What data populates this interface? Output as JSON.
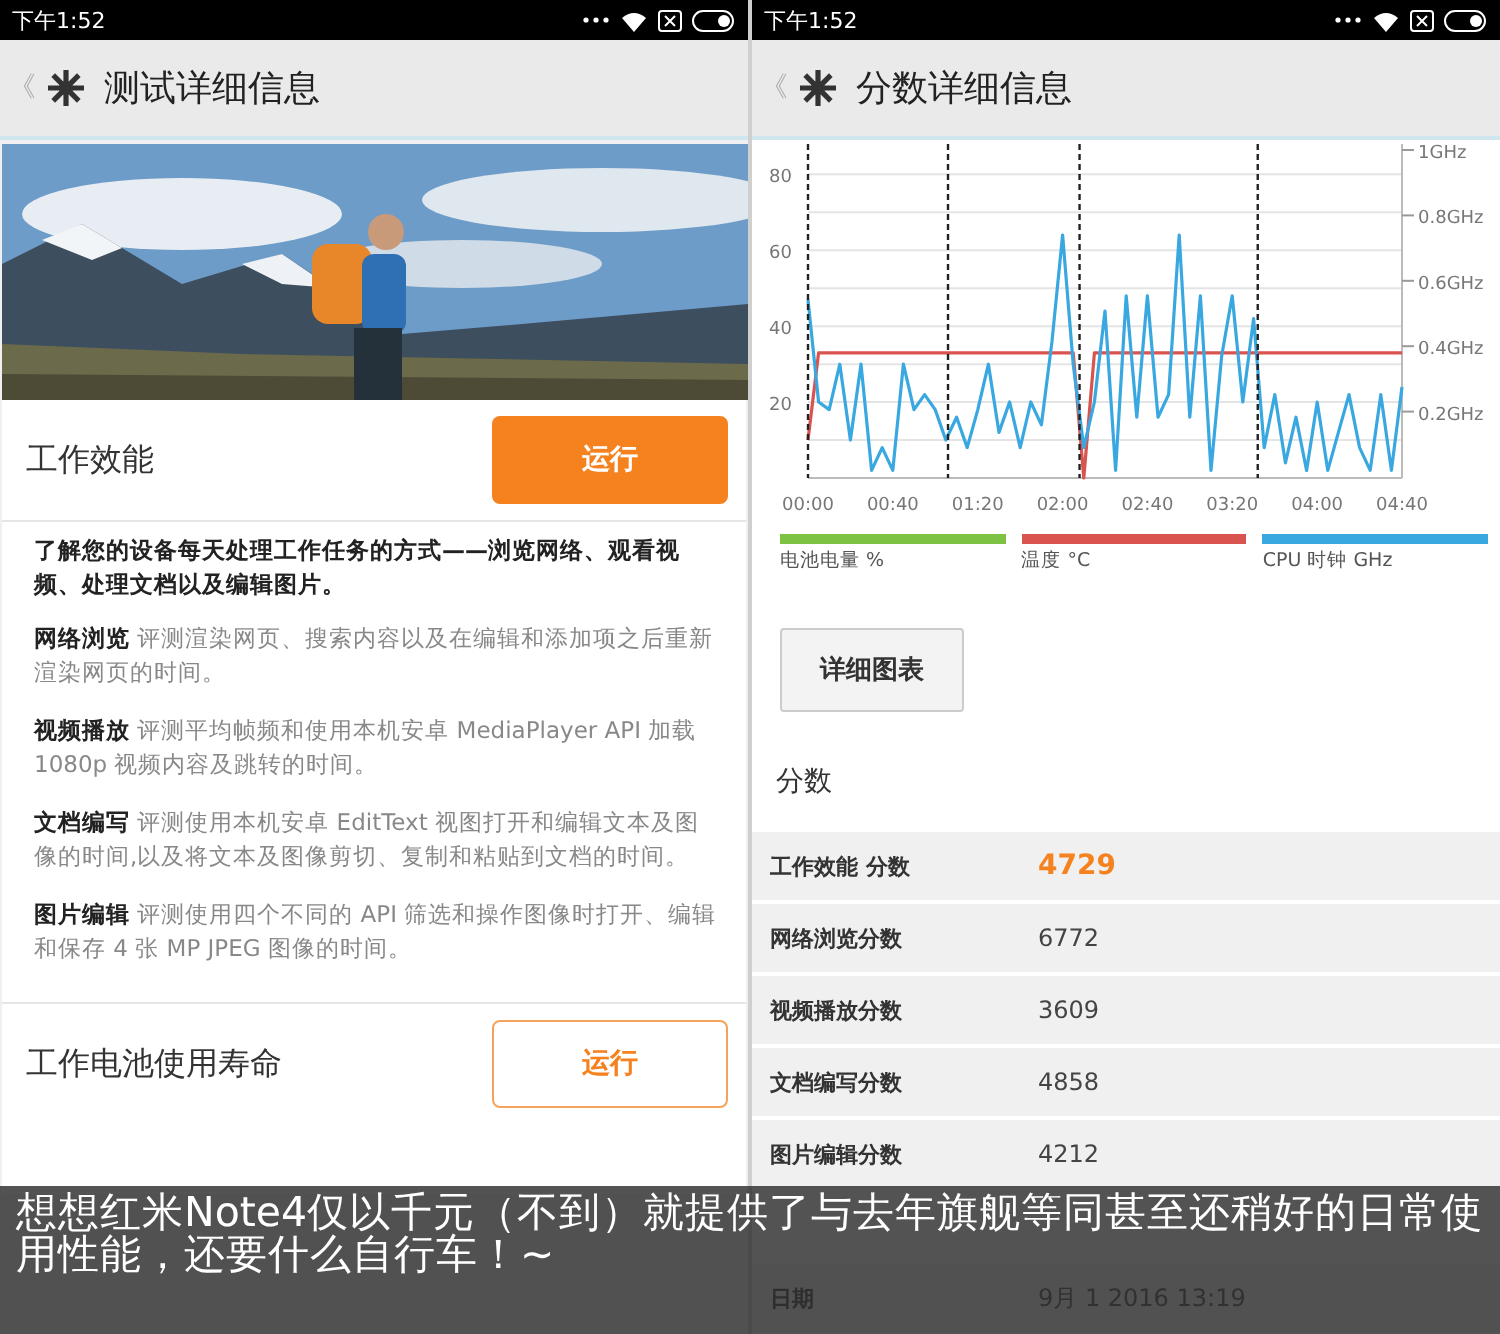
{
  "left_screen": {
    "status_bar": {
      "time": "下午1:52"
    },
    "header": {
      "back": "《",
      "title": "测试详细信息"
    },
    "photo": {
      "kind": "picture"
    },
    "tests": [
      {
        "name": "工作效能",
        "button": "运行",
        "kind": "filled"
      },
      {
        "name": "工作电池使用寿命",
        "button": "运行",
        "kind": "outlined"
      }
    ],
    "intro": "了解您的设备每天处理工作任务的方式——浏览网络、观看视频、处理文档以及编辑图片。",
    "descriptions": [
      "**网络浏览** 评测渲染网页、搜索内容以及在编辑和添加项之后重新渲染网页的时间。",
      "**视频播放** 评测平均帧频和使用本机安卓 MediaPlayer API 加载 1080p 视频内容及跳转的时间。",
      "**文档编写** 评测使用本机安卓 EditText 视图打开和编辑文本及图像的时间,以及将文本及图像剪切、复制和粘贴到文档的时间。",
      "**图片编辑** 评测使用四个不同的 API 筛选和操作图像时打开、编辑和保存 4 张 MP JPEG 图像的时间。"
    ]
  },
  "right_screen": {
    "status_bar": {
      "time": "下午1:52"
    },
    "header": {
      "back": "《",
      "title": "分数详细信息"
    },
    "chart": {
      "chart_data": {
        "type": "line",
        "xlim": [
          0,
          280
        ],
        "ylim": [
          0,
          88
        ],
        "grid": true,
        "x": [
          0,
          5,
          10,
          15,
          20,
          25,
          30,
          35,
          40,
          45,
          50,
          55,
          60,
          65,
          70,
          75,
          80,
          85,
          90,
          95,
          100,
          105,
          110,
          115,
          120,
          125,
          130,
          135,
          140,
          145,
          150,
          155,
          160,
          165,
          170,
          175,
          180,
          185,
          190,
          195,
          200,
          205,
          210,
          215,
          220,
          225,
          230,
          235,
          240,
          245,
          250,
          255,
          260,
          265,
          270,
          275,
          280
        ],
        "series": [
          {
            "name": "电池电量 %",
            "color": "#7dc242",
            "values": [
              null,
              null,
              null,
              null,
              null,
              null,
              null,
              null,
              null,
              null,
              null,
              null,
              null,
              null,
              null,
              null,
              null,
              null,
              null,
              null,
              null,
              null,
              null,
              null,
              null,
              null,
              null,
              null,
              null,
              null,
              null,
              null,
              null,
              null,
              null,
              null,
              null,
              null,
              null,
              null,
              null,
              null,
              null,
              null,
              null,
              null,
              null,
              null,
              null,
              null,
              null,
              null,
              null,
              null,
              null,
              null,
              null
            ]
          },
          {
            "name": "温度 °C",
            "color": "#d9534f",
            "values": [
              10,
              33,
              33,
              33,
              33,
              33,
              33,
              33,
              33,
              33,
              33,
              33,
              33,
              33,
              33,
              33,
              33,
              33,
              33,
              33,
              33,
              33,
              33,
              33,
              33,
              33,
              0,
              33,
              33,
              33,
              33,
              33,
              33,
              33,
              33,
              33,
              33,
              33,
              33,
              33,
              33,
              33,
              33,
              33,
              33,
              33,
              33,
              33,
              33,
              33,
              33,
              33,
              33,
              33,
              33,
              33,
              33
            ]
          },
          {
            "name": "CPU 时钟 GHz",
            "color": "#3aa8e0",
            "values": [
              47,
              20,
              18,
              30,
              10,
              30,
              2,
              8,
              2,
              30,
              18,
              22,
              18,
              10,
              16,
              8,
              18,
              30,
              12,
              20,
              8,
              20,
              14,
              36,
              64,
              30,
              8,
              20,
              44,
              2,
              48,
              16,
              48,
              16,
              22,
              64,
              16,
              48,
              2,
              32,
              48,
              20,
              42,
              8,
              22,
              4,
              16,
              2,
              20,
              2,
              12,
              22,
              8,
              2,
              22,
              2,
              24
            ]
          }
        ],
        "xticks": [
          {
            "value": 0,
            "label": "00:00"
          },
          {
            "value": 40,
            "label": "00:40"
          },
          {
            "value": 80,
            "label": "01:20"
          },
          {
            "value": 120,
            "label": "02:00"
          },
          {
            "value": 160,
            "label": "02:40"
          },
          {
            "value": 200,
            "label": "03:20"
          },
          {
            "value": 240,
            "label": "04:00"
          },
          {
            "value": 280,
            "label": "04:40"
          }
        ],
        "yticks": [
          20,
          40,
          60,
          80
        ],
        "ref_lines": [
          {
            "axis": "x",
            "value": 0
          },
          {
            "axis": "x",
            "value": 66
          },
          {
            "axis": "x",
            "value": 128
          },
          {
            "axis": "x",
            "value": 212
          }
        ]
      },
      "right_axis_labels": [
        "1GHz",
        "0.8GHz",
        "0.6GHz",
        "0.4GHz",
        "0.2GHz"
      ]
    },
    "details_button": "详细图表",
    "scores_heading": "分数",
    "scores": [
      {
        "label": "工作效能 分数",
        "value": "4729",
        "highlighted": true
      },
      {
        "label": "网络浏览分数",
        "value": "6772",
        "highlighted": false
      },
      {
        "label": "视频播放分数",
        "value": "3609",
        "highlighted": false
      },
      {
        "label": "文档编写分数",
        "value": "4858",
        "highlighted": false
      },
      {
        "label": "图片编辑分数",
        "value": "4212",
        "highlighted": false
      }
    ],
    "date": {
      "label": "日期",
      "value": "9月 1 2016 13:19"
    }
  },
  "caption": "想想红米Note4仅以千元（不到）就提供了与去年旗舰等同甚至还稍好的日常使用性能，还要什么自行车！~"
}
